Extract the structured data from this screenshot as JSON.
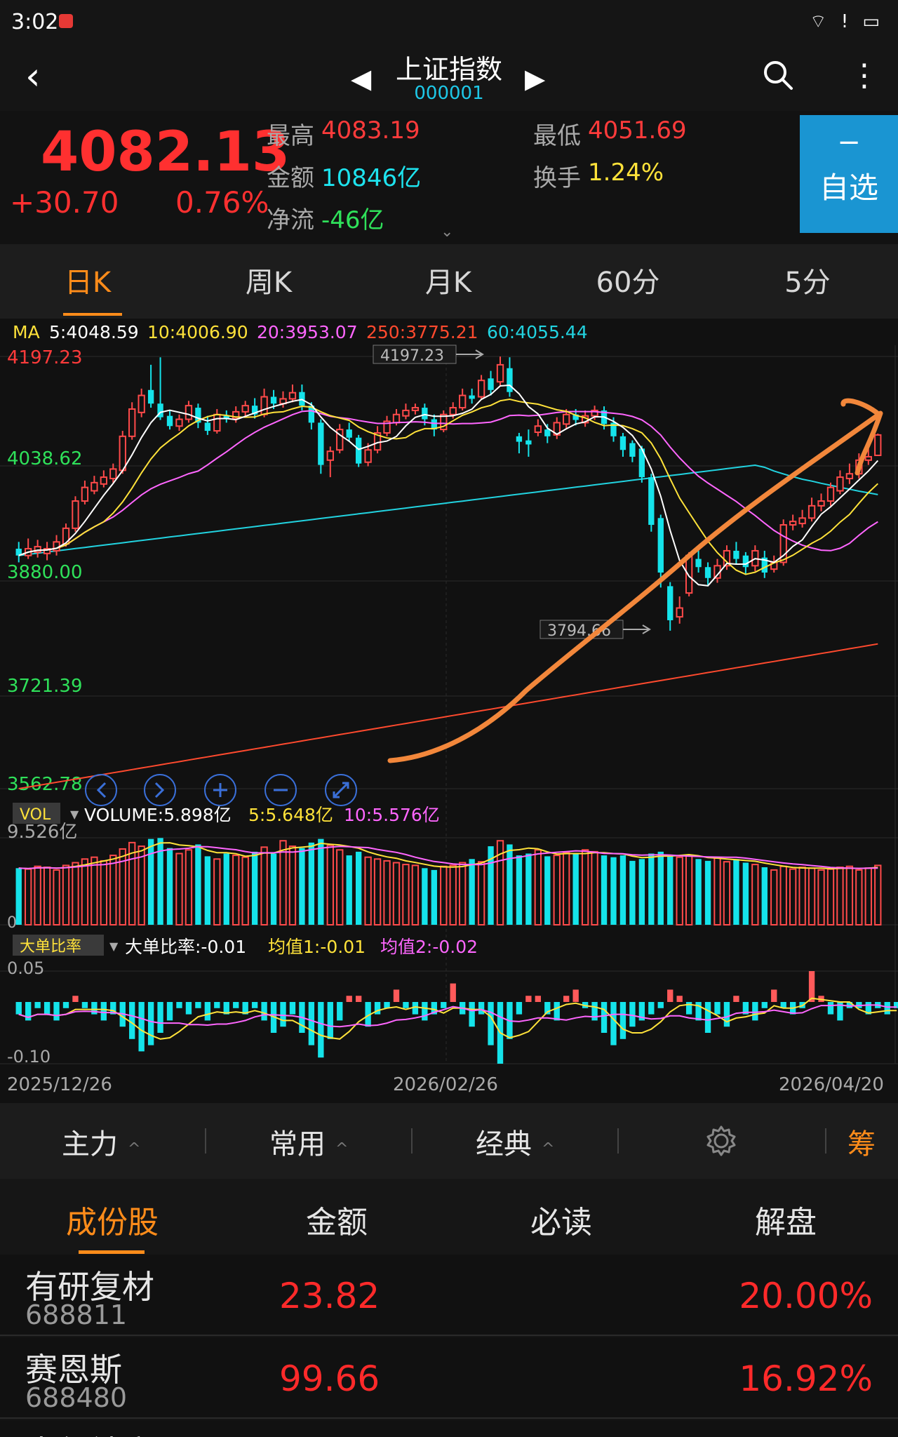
{
  "status": {
    "time": "3:02",
    "icons": "⌔ ! ▭"
  },
  "header": {
    "title": "上证指数",
    "code": "000001"
  },
  "quote": {
    "price": "4082.13",
    "change": "+30.70",
    "change_pct": "0.76%",
    "high_label": "最高",
    "high": "4083.19",
    "low_label": "最低",
    "low": "4051.69",
    "amount_label": "金额",
    "amount": "10846亿",
    "turnover_label": "换手",
    "turnover": "1.24%",
    "netflow_label": "净流",
    "netflow": "-46亿",
    "watch_minus": "−",
    "watch_label": "自选"
  },
  "period_tabs": [
    "日K",
    "周K",
    "月K",
    "60分",
    "5分"
  ],
  "chart_data": {
    "type": "candlestick",
    "ma_legend": {
      "label": "MA",
      "ma5": "5:4048.59",
      "ma10": "10:4006.90",
      "ma20": "20:3953.07",
      "ma250": "250:3775.21",
      "ma60": "60:4055.44"
    },
    "y_ticks": [
      "4197.23",
      "4038.62",
      "3880.00",
      "3721.39",
      "3562.78"
    ],
    "ylim": [
      3562.78,
      4197.23
    ],
    "high_marker": "4197.23",
    "low_marker": "3794.66",
    "x_labels": [
      "2025/12/26",
      "2026/02/26",
      "2026/04/20"
    ],
    "ma_colors": {
      "ma5": "#ffffff",
      "ma10": "#ffe23a",
      "ma20": "#ff66ff",
      "ma60": "#22d3e0",
      "ma250": "#ff4a2e"
    },
    "candles": [
      [
        3915,
        3905,
        3925,
        3895
      ],
      [
        3905,
        3915,
        3930,
        3900
      ],
      [
        3910,
        3918,
        3928,
        3902
      ],
      [
        3908,
        3915,
        3925,
        3898
      ],
      [
        3912,
        3925,
        3935,
        3905
      ],
      [
        3922,
        3945,
        3952,
        3918
      ],
      [
        3945,
        3985,
        3992,
        3940
      ],
      [
        3985,
        4005,
        4015,
        3980
      ],
      [
        4000,
        4012,
        4022,
        3995
      ],
      [
        4010,
        4020,
        4030,
        4005
      ],
      [
        4018,
        4032,
        4040,
        4012
      ],
      [
        4030,
        4080,
        4088,
        4025
      ],
      [
        4080,
        4120,
        4130,
        4075
      ],
      [
        4115,
        4140,
        4150,
        4108
      ],
      [
        4148,
        4128,
        4185,
        4122
      ],
      [
        4128,
        4108,
        4196,
        4104
      ],
      [
        4110,
        4095,
        4118,
        4090
      ],
      [
        4095,
        4105,
        4112,
        4088
      ],
      [
        4105,
        4125,
        4132,
        4100
      ],
      [
        4122,
        4100,
        4128,
        4092
      ],
      [
        4100,
        4088,
        4110,
        4082
      ],
      [
        4088,
        4112,
        4120,
        4084
      ],
      [
        4110,
        4106,
        4118,
        4100
      ],
      [
        4106,
        4116,
        4124,
        4100
      ],
      [
        4116,
        4125,
        4132,
        4110
      ],
      [
        4125,
        4112,
        4136,
        4106
      ],
      [
        4112,
        4138,
        4150,
        4108
      ],
      [
        4138,
        4128,
        4148,
        4120
      ],
      [
        4128,
        4135,
        4146,
        4122
      ],
      [
        4135,
        4144,
        4156,
        4130
      ],
      [
        4145,
        4125,
        4156,
        4118
      ],
      [
        4125,
        4100,
        4130,
        4090
      ],
      [
        4100,
        4038,
        4105,
        4025
      ],
      [
        4045,
        4058,
        4065,
        4020
      ],
      [
        4060,
        4090,
        4098,
        4055
      ],
      [
        4090,
        4078,
        4100,
        4072
      ],
      [
        4078,
        4040,
        4082,
        4035
      ],
      [
        4042,
        4060,
        4070,
        4036
      ],
      [
        4060,
        4085,
        4095,
        4055
      ],
      [
        4085,
        4102,
        4110,
        4080
      ],
      [
        4100,
        4112,
        4120,
        4096
      ],
      [
        4110,
        4118,
        4128,
        4105
      ],
      [
        4118,
        4122,
        4128,
        4112
      ],
      [
        4122,
        4105,
        4128,
        4096
      ],
      [
        4105,
        4090,
        4112,
        4080
      ],
      [
        4090,
        4112,
        4118,
        4086
      ],
      [
        4112,
        4122,
        4130,
        4106
      ],
      [
        4122,
        4140,
        4150,
        4118
      ],
      [
        4140,
        4135,
        4150,
        4128
      ],
      [
        4138,
        4162,
        4170,
        4134
      ],
      [
        4165,
        4148,
        4176,
        4140
      ],
      [
        4160,
        4185,
        4197,
        4155
      ],
      [
        4180,
        4145,
        4196,
        4138
      ],
      [
        4080,
        4072,
        4085,
        4055
      ],
      [
        4074,
        4068,
        4090,
        4050
      ],
      [
        4086,
        4095,
        4105,
        4080
      ],
      [
        4090,
        4080,
        4098,
        4070
      ],
      [
        4082,
        4100,
        4108,
        4076
      ],
      [
        4098,
        4112,
        4120,
        4090
      ],
      [
        4112,
        4104,
        4120,
        4096
      ],
      [
        4100,
        4110,
        4118,
        4094
      ],
      [
        4110,
        4118,
        4125,
        4104
      ],
      [
        4118,
        4098,
        4124,
        4090
      ],
      [
        4100,
        4080,
        4108,
        4072
      ],
      [
        4080,
        4060,
        4085,
        4050
      ],
      [
        4070,
        4050,
        4074,
        4042
      ],
      [
        4062,
        4020,
        4066,
        4012
      ],
      [
        4020,
        3950,
        4025,
        3940
      ],
      [
        3960,
        3880,
        3965,
        3858
      ],
      [
        3860,
        3810,
        3866,
        3794.66
      ],
      [
        3815,
        3828,
        3845,
        3805
      ],
      [
        3850,
        3905,
        3910,
        3845
      ],
      [
        3900,
        3888,
        3915,
        3880
      ],
      [
        3888,
        3872,
        3895,
        3862
      ],
      [
        3872,
        3890,
        3900,
        3865
      ],
      [
        3890,
        3912,
        3920,
        3884
      ],
      [
        3912,
        3900,
        3925,
        3892
      ],
      [
        3905,
        3888,
        3910,
        3878
      ],
      [
        3890,
        3912,
        3920,
        3882
      ],
      [
        3902,
        3880,
        3912,
        3872
      ],
      [
        3885,
        3895,
        3905,
        3880
      ],
      [
        3895,
        3950,
        3958,
        3890
      ],
      [
        3950,
        3955,
        3965,
        3942
      ],
      [
        3952,
        3960,
        3972,
        3946
      ],
      [
        3960,
        3978,
        3990,
        3955
      ],
      [
        3978,
        3985,
        3996,
        3970
      ],
      [
        3985,
        4005,
        4012,
        3978
      ],
      [
        4000,
        4020,
        4030,
        3995
      ],
      [
        4018,
        4025,
        4040,
        4010
      ],
      [
        4025,
        4045,
        4055,
        4018
      ],
      [
        4045,
        4050,
        4062,
        4038
      ],
      [
        4052,
        4082,
        4084,
        4052
      ]
    ],
    "volume": {
      "label": "VOL",
      "legend": "VOLUME:5.898亿",
      "ma5": "5:5.648亿",
      "ma10": "10:5.576亿",
      "ymax_label": "9.526亿",
      "ymin_label": "0",
      "values": [
        6.2,
        6.1,
        6.4,
        6.3,
        6.0,
        6.5,
        6.8,
        7.2,
        7.4,
        7.0,
        7.6,
        8.3,
        9.0,
        8.6,
        9.4,
        9.5,
        8.4,
        7.8,
        8.2,
        8.8,
        7.5,
        7.2,
        7.8,
        7.6,
        7.4,
        8.0,
        8.5,
        7.8,
        9.2,
        8.6,
        8.4,
        9.0,
        9.4,
        8.7,
        8.2,
        7.6,
        8.0,
        7.4,
        7.2,
        7.0,
        6.8,
        6.6,
        6.5,
        6.2,
        6.0,
        6.4,
        6.5,
        6.8,
        7.2,
        6.9,
        8.6,
        9.2,
        8.8,
        7.6,
        7.8,
        8.2,
        7.5,
        7.6,
        7.9,
        7.8,
        8.2,
        8.0,
        7.6,
        7.4,
        7.6,
        7.0,
        7.2,
        7.8,
        8.0,
        7.6,
        7.4,
        7.6,
        7.2,
        7.0,
        7.3,
        6.9,
        7.2,
        6.8,
        6.6,
        6.3,
        6.0,
        6.4,
        6.1,
        6.3,
        6.2,
        6.0,
        6.1,
        6.3,
        6.4,
        6.0,
        6.2,
        6.5
      ]
    },
    "large_order": {
      "label": "大单比率",
      "legend": "大单比率:-0.01",
      "avg1": "均值1:-0.01",
      "avg2": "均值2:-0.02",
      "ymax_label": "0.05",
      "ymin_label": "-0.10",
      "values": [
        -0.02,
        -0.03,
        -0.01,
        -0.02,
        -0.03,
        -0.01,
        0.01,
        -0.01,
        -0.02,
        -0.03,
        -0.02,
        -0.04,
        -0.06,
        -0.08,
        -0.07,
        -0.05,
        -0.03,
        -0.01,
        -0.02,
        -0.01,
        -0.03,
        -0.01,
        -0.02,
        -0.01,
        -0.02,
        -0.01,
        -0.03,
        -0.05,
        -0.04,
        -0.02,
        -0.05,
        -0.07,
        -0.09,
        -0.06,
        -0.03,
        0.01,
        0.01,
        -0.04,
        -0.02,
        -0.01,
        0.02,
        -0.01,
        -0.02,
        -0.03,
        -0.02,
        -0.01,
        0.03,
        -0.02,
        -0.04,
        -0.02,
        -0.07,
        -0.1,
        -0.06,
        -0.02,
        0.01,
        0.01,
        -0.02,
        -0.03,
        0.01,
        0.02,
        -0.01,
        -0.03,
        -0.05,
        -0.07,
        -0.06,
        -0.04,
        -0.03,
        -0.02,
        -0.01,
        0.02,
        0.01,
        -0.02,
        -0.03,
        -0.05,
        -0.02,
        -0.04,
        0.01,
        -0.02,
        -0.03,
        -0.01,
        0.02,
        -0.01,
        -0.02,
        -0.01,
        0.05,
        0.01,
        -0.02,
        -0.03,
        -0.01,
        -0.01,
        -0.02,
        -0.01,
        -0.02,
        -0.01
      ]
    }
  },
  "toolbar": {
    "items": [
      "主力",
      "常用",
      "经典",
      "筹"
    ]
  },
  "list_tabs": [
    "成份股",
    "金额",
    "必读",
    "解盘"
  ],
  "stocks": [
    {
      "name": "有研复材",
      "code": "688811",
      "price": "23.82",
      "pct": "20.00%"
    },
    {
      "name": "赛恩斯",
      "code": "688480",
      "price": "99.66",
      "pct": "16.92%"
    },
    {
      "name": "中复神鹰",
      "code": "",
      "price": "",
      "pct": ""
    }
  ]
}
